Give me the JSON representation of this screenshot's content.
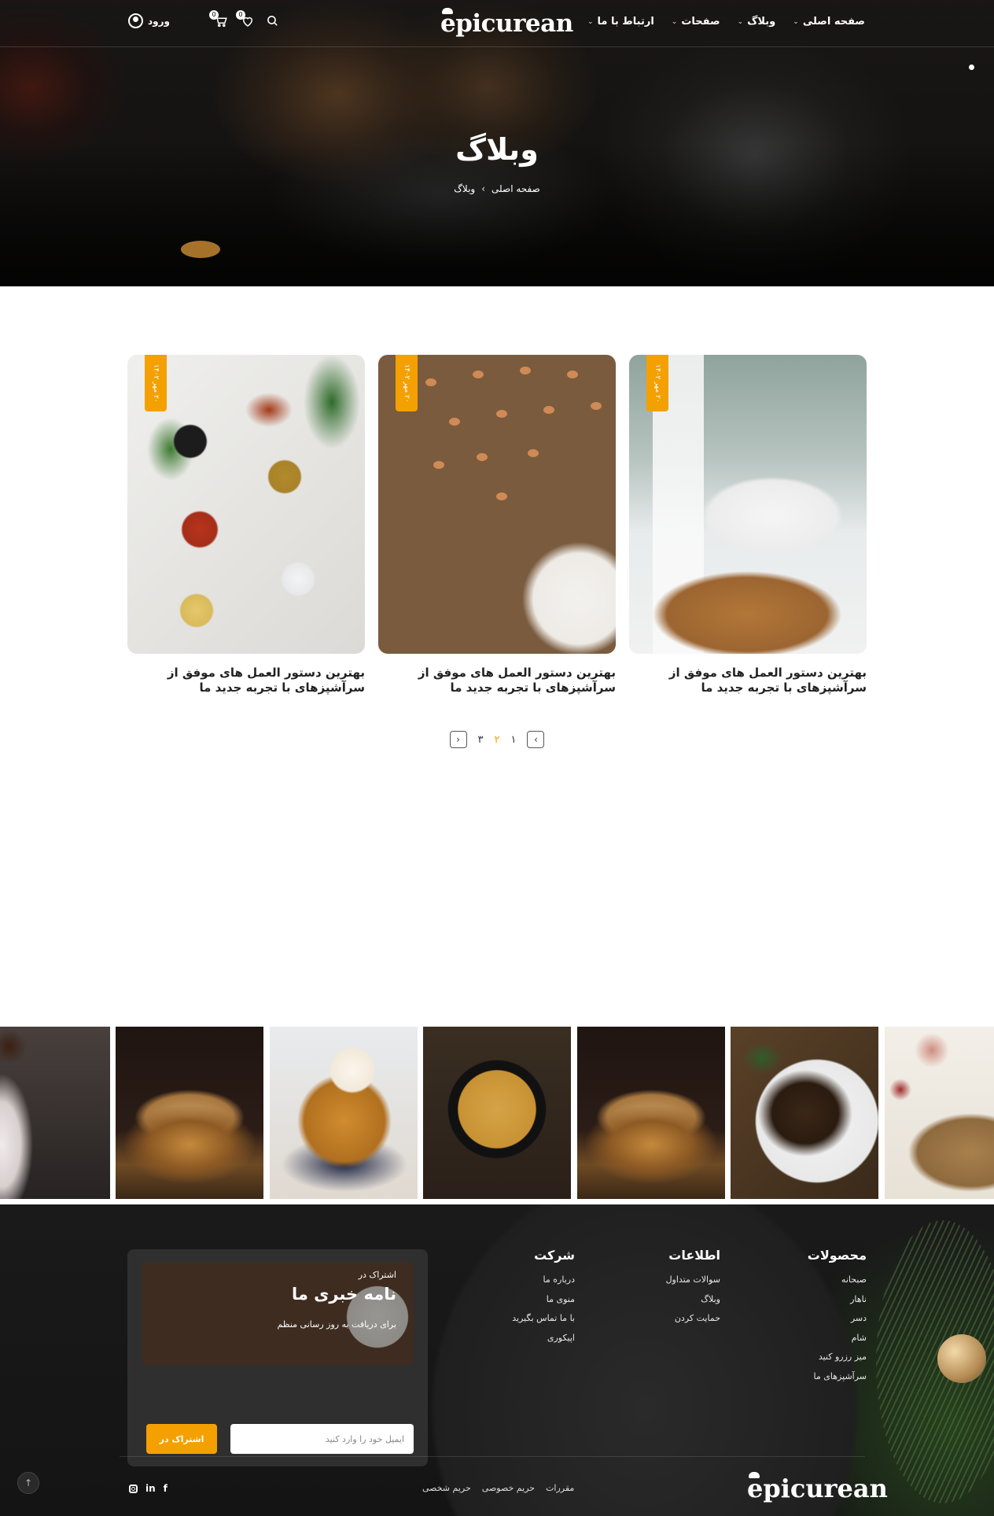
{
  "header": {
    "logo": "epicurean",
    "login_label": "ورود",
    "cart_count": "0",
    "wishlist_count": "0",
    "nav": [
      "صفحه اصلی",
      "وبلاگ",
      "صفحات",
      "ارتباط با ما"
    ]
  },
  "hero": {
    "title": "وبلاگ",
    "breadcrumb": {
      "home": "صفحه اصلی",
      "separator": "›",
      "current": "وبلاگ"
    }
  },
  "posts": [
    {
      "date": "۲۰ مهر ۱۴۰۲",
      "title": "بهترین دستور العمل های موفق از سرآشپزهای با تجربه جدید ما"
    },
    {
      "date": "۲۰ مهر ۱۴۰۲",
      "title": "بهترین دستور العمل های موفق از سرآشپزهای با تجربه جدید ما"
    },
    {
      "date": "۲۰ مهر ۱۴۰۲",
      "title": "بهترین دستور العمل های موفق از سرآشپزهای با تجربه جدید ما"
    }
  ],
  "pagination": {
    "prev": "›",
    "next": "‹",
    "pages": [
      "۱",
      "۲",
      "۳"
    ],
    "current": "۲"
  },
  "photo_strip": [
    "chocolate",
    "burger",
    "pancakes",
    "shrimp-rice",
    "burger",
    "grilled-meat",
    "cheese-board"
  ],
  "footer": {
    "columns": [
      {
        "heading": "محصولات",
        "links": [
          "صبحانه",
          "ناهار",
          "دسر",
          "شام",
          "میز رزرو کنید",
          "سرآشپزهای ما"
        ]
      },
      {
        "heading": "اطلاعات",
        "links": [
          "سوالات متداول",
          "وبلاگ",
          "حمایت کردن"
        ]
      },
      {
        "heading": "شرکت",
        "links": [
          "درباره ما",
          "منوی ما",
          "با ما تماس بگیرید",
          "اپیکوری"
        ]
      }
    ],
    "newsletter": {
      "pre": "اشتراک در",
      "title": "نامه خبری ما",
      "subtitle": "برای دریافت به روز رسانی منظم",
      "email_placeholder": "ایمیل خود را وارد کنید",
      "button": "اشتراک در"
    },
    "logo": "epicurean",
    "bottom_links": [
      "مقررات",
      "حریم خصوصی",
      "حریم شخصی"
    ],
    "social": [
      "facebook",
      "linkedin",
      "instagram"
    ],
    "accent_color": "#f4a000"
  }
}
